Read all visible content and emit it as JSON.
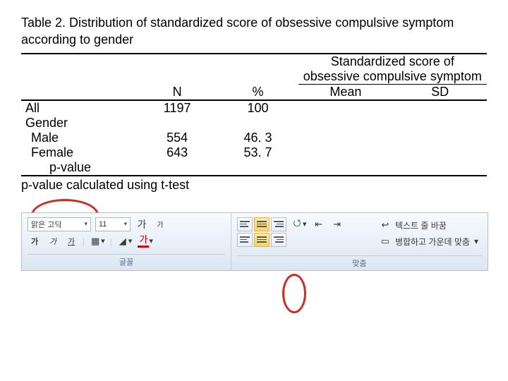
{
  "table": {
    "title": "Table 2. Distribution of standardized score of obsessive compulsive symptom according to gender",
    "spanner": "Standardized score of obsessive compulsive symptom",
    "cols": {
      "n": "N",
      "pct": "%",
      "mean": "Mean",
      "sd": "SD"
    },
    "rows": {
      "all": {
        "label": "All",
        "n": "1197",
        "pct": "100"
      },
      "gender": {
        "label": "Gender"
      },
      "male": {
        "label": "Male",
        "n": "554",
        "pct": "46. 3"
      },
      "female": {
        "label": "Female",
        "n": "643",
        "pct": "53. 7"
      },
      "pval": {
        "label": "p-value"
      }
    },
    "footnote": "p-value calculated using t-test"
  },
  "ribbon": {
    "font_group_label": "글꼴",
    "align_group_label": "맞춤",
    "font_name": "맑은 고딕",
    "font_size": "11",
    "grow": "가",
    "shrink": "가",
    "bold": "가",
    "italic": "가",
    "underline": "가",
    "wrap_text": "텍스트 줄 바꿈",
    "merge_center": "병합하고 가운데 맞춤"
  }
}
